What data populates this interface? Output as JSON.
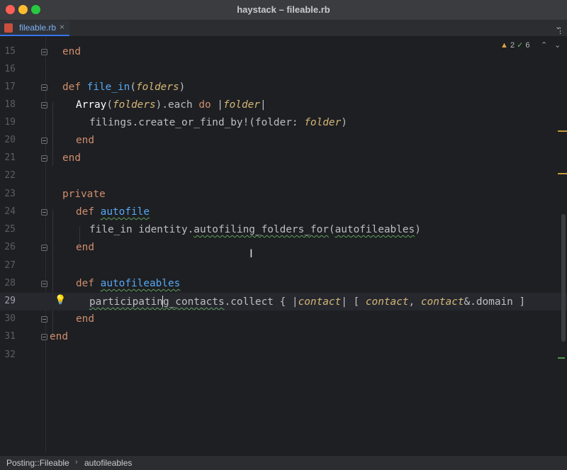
{
  "window": {
    "title": "haystack – fileable.rb"
  },
  "tabs": [
    {
      "label": "fileable.rb",
      "icon": "ruby-file-icon",
      "close_glyph": "×"
    }
  ],
  "inspections": {
    "warnings": "2",
    "weak_warnings": "6",
    "warning_glyph": "▲",
    "ok_glyph": "✓"
  },
  "editor": {
    "current_line": 29,
    "line_numbers": [
      "15",
      "16",
      "17",
      "18",
      "19",
      "20",
      "21",
      "22",
      "23",
      "24",
      "25",
      "26",
      "27",
      "28",
      "29",
      "30",
      "31",
      "32"
    ]
  },
  "code": {
    "l15": {
      "end": "end"
    },
    "l17": {
      "def": "def",
      "name": "file_in",
      "open": "(",
      "param": "folders",
      "close": ")"
    },
    "l18": {
      "const": "Array",
      "open": "(",
      "arg": "folders",
      "rest": ").each ",
      "do": "do",
      "pipe1": " |",
      "blockvar": "folder",
      "pipe2": "|"
    },
    "l19": {
      "text": "filings.create_or_find_by!(folder: ",
      "arg": "folder",
      "close": ")"
    },
    "l20": {
      "end": "end"
    },
    "l21": {
      "end": "end"
    },
    "l23": {
      "kw": "private"
    },
    "l24": {
      "def": "def",
      "name": "autofile"
    },
    "l25": {
      "pre": "file_in identity.",
      "method": "autofiling_folders_for",
      "open": "(",
      "arg": "autofileables",
      "close": ")"
    },
    "l26": {
      "end": "end"
    },
    "l28": {
      "def": "def",
      "name": "autofileables"
    },
    "l29": {
      "pre": "participatin",
      "post": "g_contacts",
      "rest": ".collect { |",
      "blockvar": "contact",
      "mid": "| [ ",
      "v1": "contact",
      "comma": ", ",
      "v2": "contact",
      "tail": "&.domain ]"
    },
    "l30": {
      "end": "end"
    },
    "l31": {
      "end": "end"
    }
  },
  "breadcrumb": {
    "items": [
      "Posting::Fileable",
      "autofileables"
    ],
    "separator": "›"
  }
}
